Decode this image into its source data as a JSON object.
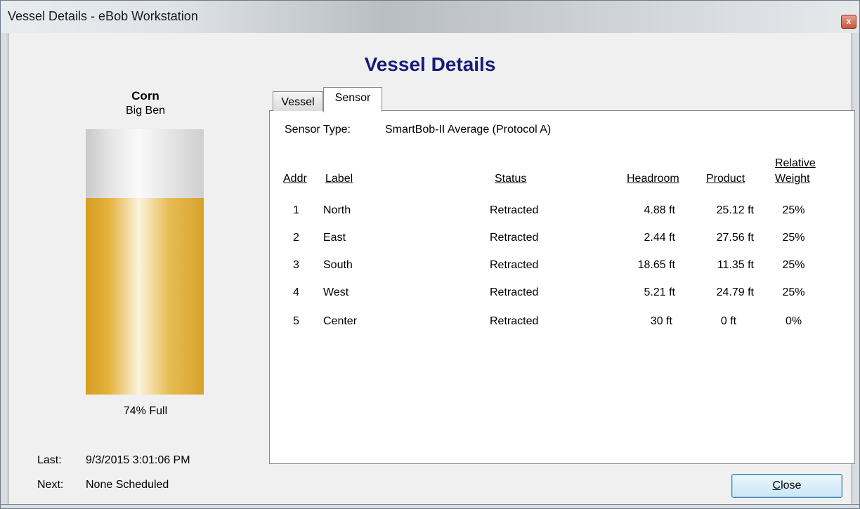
{
  "window": {
    "title": "Vessel Details - eBob Workstation",
    "close_glyph": "x"
  },
  "heading": "Vessel Details",
  "vessel": {
    "product": "Corn",
    "name": "Big Ben",
    "fill_fraction": 0.74,
    "fill_label": "74% Full",
    "last_label": "Last:",
    "last_value": "9/3/2015 3:01:06 PM",
    "next_label": "Next:",
    "next_value": "None Scheduled"
  },
  "tabs": [
    {
      "label": "Vessel",
      "selected": false
    },
    {
      "label": "Sensor",
      "selected": true
    }
  ],
  "sensor": {
    "type_label": "Sensor Type:",
    "type_value": "SmartBob-II Average (Protocol A)",
    "columns": {
      "addr": "Addr",
      "label": "Label",
      "status": "Status",
      "headroom": "Headroom",
      "product": "Product",
      "weight_line1": "Relative",
      "weight_line2": "Weight"
    },
    "rows": [
      {
        "addr": "1",
        "label": "North",
        "status": "Retracted",
        "headroom": "4.88 ft",
        "product": "25.12 ft",
        "weight": "25%"
      },
      {
        "addr": "2",
        "label": "East",
        "status": "Retracted",
        "headroom": "2.44 ft",
        "product": "27.56 ft",
        "weight": "25%"
      },
      {
        "addr": "3",
        "label": "South",
        "status": "Retracted",
        "headroom": "18.65 ft",
        "product": "11.35 ft",
        "weight": "25%"
      },
      {
        "addr": "4",
        "label": "West",
        "status": "Retracted",
        "headroom": "5.21 ft",
        "product": "24.79 ft",
        "weight": "25%"
      },
      {
        "addr": "5",
        "label": "Center",
        "status": "Retracted",
        "headroom": "30 ft",
        "product": "0 ft",
        "weight": "0%"
      }
    ]
  },
  "buttons": {
    "close_first": "C",
    "close_rest": "lose"
  },
  "colors": {
    "heading": "#1a1a7a",
    "tank_fill": "#e4b23f"
  }
}
